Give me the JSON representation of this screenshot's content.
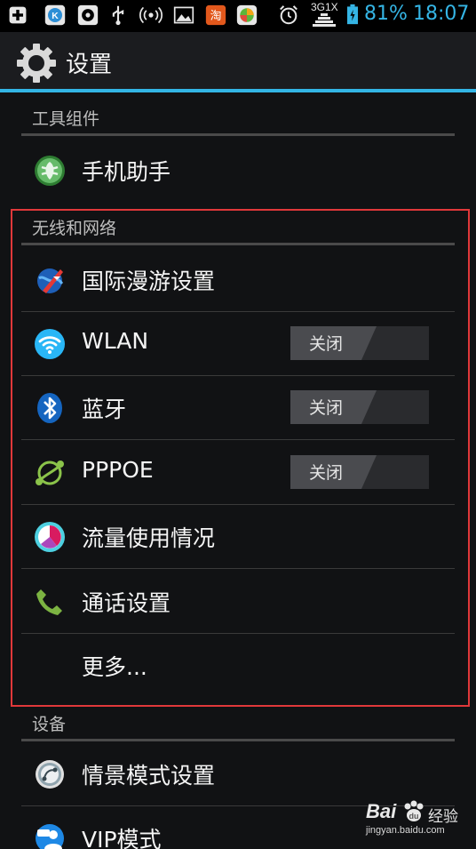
{
  "statusbar": {
    "network": "3G1X",
    "battery": "81%",
    "time": "18:07"
  },
  "header": {
    "title": "设置"
  },
  "sections": {
    "tools": {
      "header": "工具组件",
      "items": [
        {
          "label": "手机助手"
        }
      ]
    },
    "wireless": {
      "header": "无线和网络",
      "items": [
        {
          "label": "国际漫游设置"
        },
        {
          "label": "WLAN",
          "toggle": "关闭"
        },
        {
          "label": "蓝牙",
          "toggle": "关闭"
        },
        {
          "label": "PPPOE",
          "toggle": "关闭"
        },
        {
          "label": "流量使用情况"
        },
        {
          "label": "通话设置"
        },
        {
          "label": "更多..."
        }
      ]
    },
    "device": {
      "header": "设备",
      "items": [
        {
          "label": "情景模式设置"
        },
        {
          "label": "VIP模式"
        }
      ]
    }
  },
  "watermark": {
    "brand": "Bai",
    "brand2": "经验",
    "url": "jingyan.baidu.com"
  },
  "colors": {
    "accent": "#33b5e5",
    "highlight": "#e0383a"
  }
}
